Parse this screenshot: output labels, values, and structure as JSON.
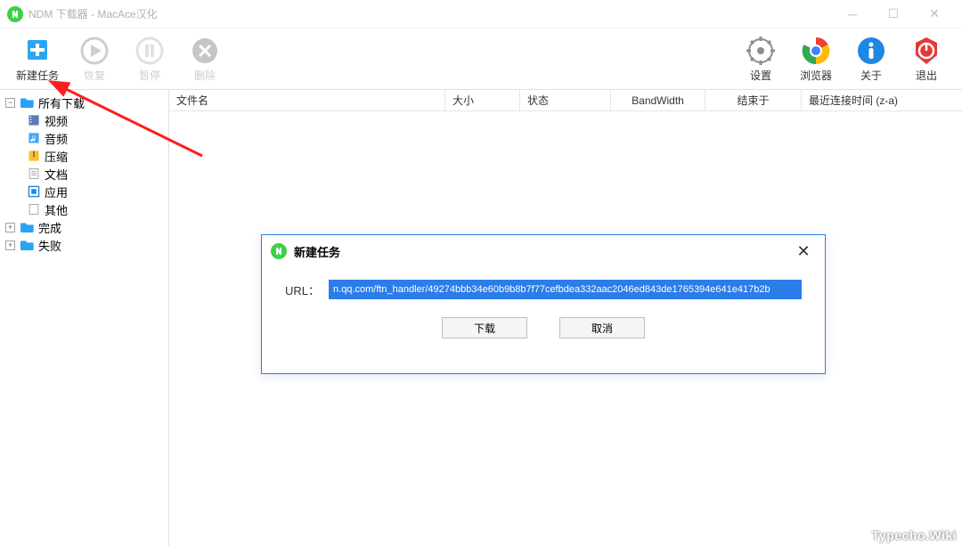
{
  "window": {
    "title": "NDM 下载器 - MacAce汉化"
  },
  "toolbar": {
    "left": [
      {
        "key": "new-task",
        "label": "新建任务",
        "disabled": false,
        "color": "#2aa7f3"
      },
      {
        "key": "resume",
        "label": "恢复",
        "disabled": true,
        "color": "#2aa7f3"
      },
      {
        "key": "pause",
        "label": "暂停",
        "disabled": true,
        "color": "#f2b84b"
      },
      {
        "key": "delete",
        "label": "删除",
        "disabled": true,
        "color": "#f0604e"
      }
    ],
    "right": [
      {
        "key": "settings",
        "label": "设置",
        "color": "#8e8e8e"
      },
      {
        "key": "browser",
        "label": "浏览器",
        "color": "#ffce44"
      },
      {
        "key": "about",
        "label": "关于",
        "color": "#1e88e5"
      },
      {
        "key": "exit",
        "label": "退出",
        "color": "#e53935"
      }
    ]
  },
  "sidebar": {
    "root": {
      "label": "所有下载",
      "children": [
        {
          "key": "video",
          "label": "视频"
        },
        {
          "key": "audio",
          "label": "音频"
        },
        {
          "key": "archive",
          "label": "压缩"
        },
        {
          "key": "doc",
          "label": "文档"
        },
        {
          "key": "app",
          "label": "应用"
        },
        {
          "key": "other",
          "label": "其他"
        }
      ]
    },
    "completed": {
      "label": "完成"
    },
    "failed": {
      "label": "失败"
    }
  },
  "table": {
    "columns": {
      "filename": "文件名",
      "size": "大小",
      "status": "状态",
      "bandwidth": "BandWidth",
      "end": "结束于",
      "last": "最近连接时间 (z-a)"
    }
  },
  "dialog": {
    "title": "新建任务",
    "url_label": "URL：",
    "url_value": "n.qq.com/ftn_handler/49274bbb34e60b9b8b7f77cefbdea332aac2046ed843de1765394e641e417b2b",
    "download": "下载",
    "cancel": "取消"
  },
  "watermark": "Typecho.Wiki"
}
